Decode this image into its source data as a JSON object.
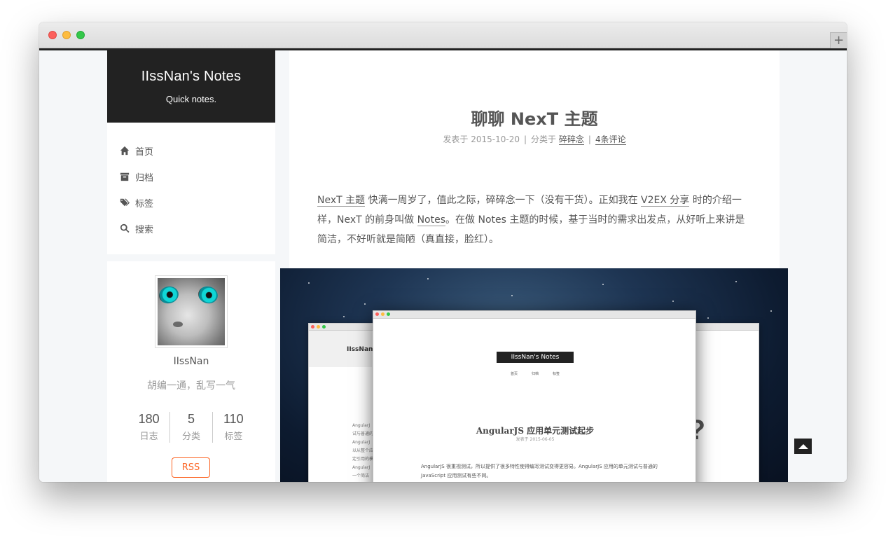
{
  "site": {
    "title": "IIssNan's Notes",
    "subtitle": "Quick notes."
  },
  "menu": {
    "items": [
      {
        "label": "首页",
        "icon": "home-icon"
      },
      {
        "label": "归档",
        "icon": "archive-icon"
      },
      {
        "label": "标签",
        "icon": "tags-icon"
      },
      {
        "label": "搜索",
        "icon": "search-icon"
      }
    ]
  },
  "profile": {
    "name": "IIssNan",
    "description": "胡编一通，乱写一气",
    "stats": [
      {
        "count": "180",
        "label": "日志"
      },
      {
        "count": "5",
        "label": "分类"
      },
      {
        "count": "110",
        "label": "标签"
      }
    ],
    "rss_label": "RSS"
  },
  "post": {
    "title": "聊聊 NexT 主题",
    "meta": {
      "posted_prefix": "发表于 2015-10-20",
      "category_prefix": "分类于",
      "category": "碎碎念",
      "comments": "4条评论"
    },
    "body": {
      "link1": "NexT 主题",
      "text1": " 快满一周岁了，值此之际，碎碎念一下（没有干货）。正如我在 ",
      "link2": "V2EX 分享",
      "text2": " 时的介绍一样，NexT 的前身叫做 ",
      "link3": "Notes",
      "text3": "。在做 Notes 主题的时候，基于当时的需求出发点，从好听上来讲是简洁，不好听就是简陋（真直接，脸红）。"
    }
  },
  "hero_mockup": {
    "back_brand": "IIssNan'",
    "front_brand": "IIssNan's Notes",
    "front_menu": [
      "首页",
      "归档",
      "标签"
    ],
    "front_title": "AngularJS 应用单元测试起步",
    "front_date": "发表于 2015-06-05",
    "front_text": "AngularJS 很重视测试，所以提供了很多特性使得编写测试变得更容易。AngularJS 应用的单元测试与普通的 JavaScript 应用测试有些不同。",
    "back_sidebar_text": [
      "AngularJ",
      "试与普通的",
      "AngularJ",
      "以从整个应",
      "定引用的模",
      "AngularJ",
      "一个简洁"
    ],
    "back_q": "?"
  },
  "colors": {
    "accent": "#fc6423",
    "brand_bg": "#222222",
    "page_bg": "#f5f7f9"
  }
}
